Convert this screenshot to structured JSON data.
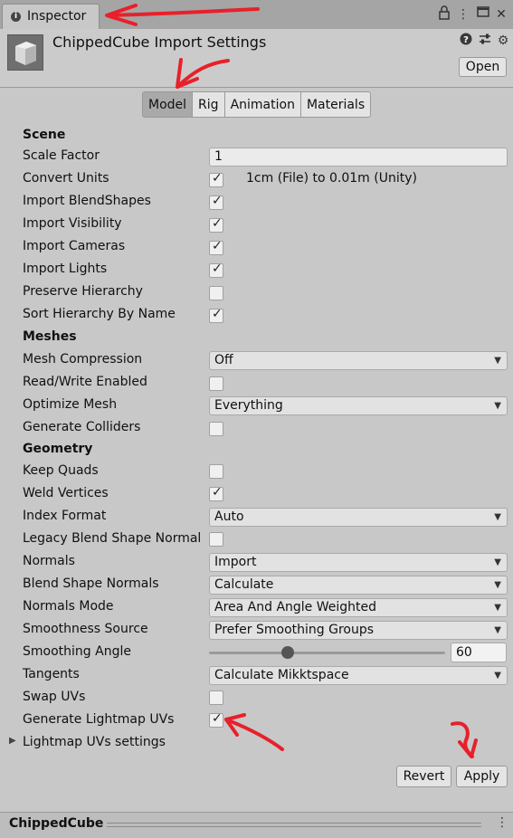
{
  "window": {
    "tab_label": "Inspector",
    "icons": [
      "lock-icon",
      "kebab-menu-icon",
      "maximize-icon",
      "close-icon"
    ]
  },
  "header": {
    "title": "ChippedCube Import Settings",
    "open_label": "Open",
    "icons": [
      "help-icon",
      "presets-icon",
      "settings-icon"
    ]
  },
  "tabs": [
    {
      "label": "Model",
      "active": true
    },
    {
      "label": "Rig",
      "active": false
    },
    {
      "label": "Animation",
      "active": false
    },
    {
      "label": "Materials",
      "active": false
    }
  ],
  "scene": {
    "heading": "Scene",
    "scale_factor_label": "Scale Factor",
    "scale_factor_value": "1",
    "convert_units_label": "Convert Units",
    "convert_units_checked": true,
    "convert_units_note": "1cm (File) to 0.01m (Unity)",
    "import_blendshapes_label": "Import BlendShapes",
    "import_visibility_label": "Import Visibility",
    "import_cameras_label": "Import Cameras",
    "import_lights_label": "Import Lights",
    "preserve_hierarchy_label": "Preserve Hierarchy",
    "sort_hierarchy_label": "Sort Hierarchy By Name"
  },
  "meshes": {
    "heading": "Meshes",
    "mesh_compression_label": "Mesh Compression",
    "mesh_compression_value": "Off",
    "read_write_label": "Read/Write Enabled",
    "optimize_mesh_label": "Optimize Mesh",
    "optimize_mesh_value": "Everything",
    "generate_colliders_label": "Generate Colliders"
  },
  "geometry": {
    "heading": "Geometry",
    "keep_quads_label": "Keep Quads",
    "weld_vertices_label": "Weld Vertices",
    "index_format_label": "Index Format",
    "index_format_value": "Auto",
    "legacy_blend_label": "Legacy Blend Shape Normal",
    "normals_label": "Normals",
    "normals_value": "Import",
    "blend_shape_normals_label": "Blend Shape Normals",
    "blend_shape_normals_value": "Calculate",
    "normals_mode_label": "Normals Mode",
    "normals_mode_value": "Area And Angle Weighted",
    "smoothness_source_label": "Smoothness Source",
    "smoothness_source_value": "Prefer Smoothing Groups",
    "smoothing_angle_label": "Smoothing Angle",
    "smoothing_angle_value": "60",
    "smoothing_angle_fraction": 0.333,
    "tangents_label": "Tangents",
    "tangents_value": "Calculate Mikktspace",
    "swap_uvs_label": "Swap UVs",
    "generate_lightmap_label": "Generate Lightmap UVs",
    "lightmap_settings_label": "Lightmap UVs settings"
  },
  "buttons": {
    "revert": "Revert",
    "apply": "Apply"
  },
  "footer": {
    "name": "ChippedCube"
  },
  "colors": {
    "annotation": "#e8202a",
    "background": "#c8c8c8"
  }
}
